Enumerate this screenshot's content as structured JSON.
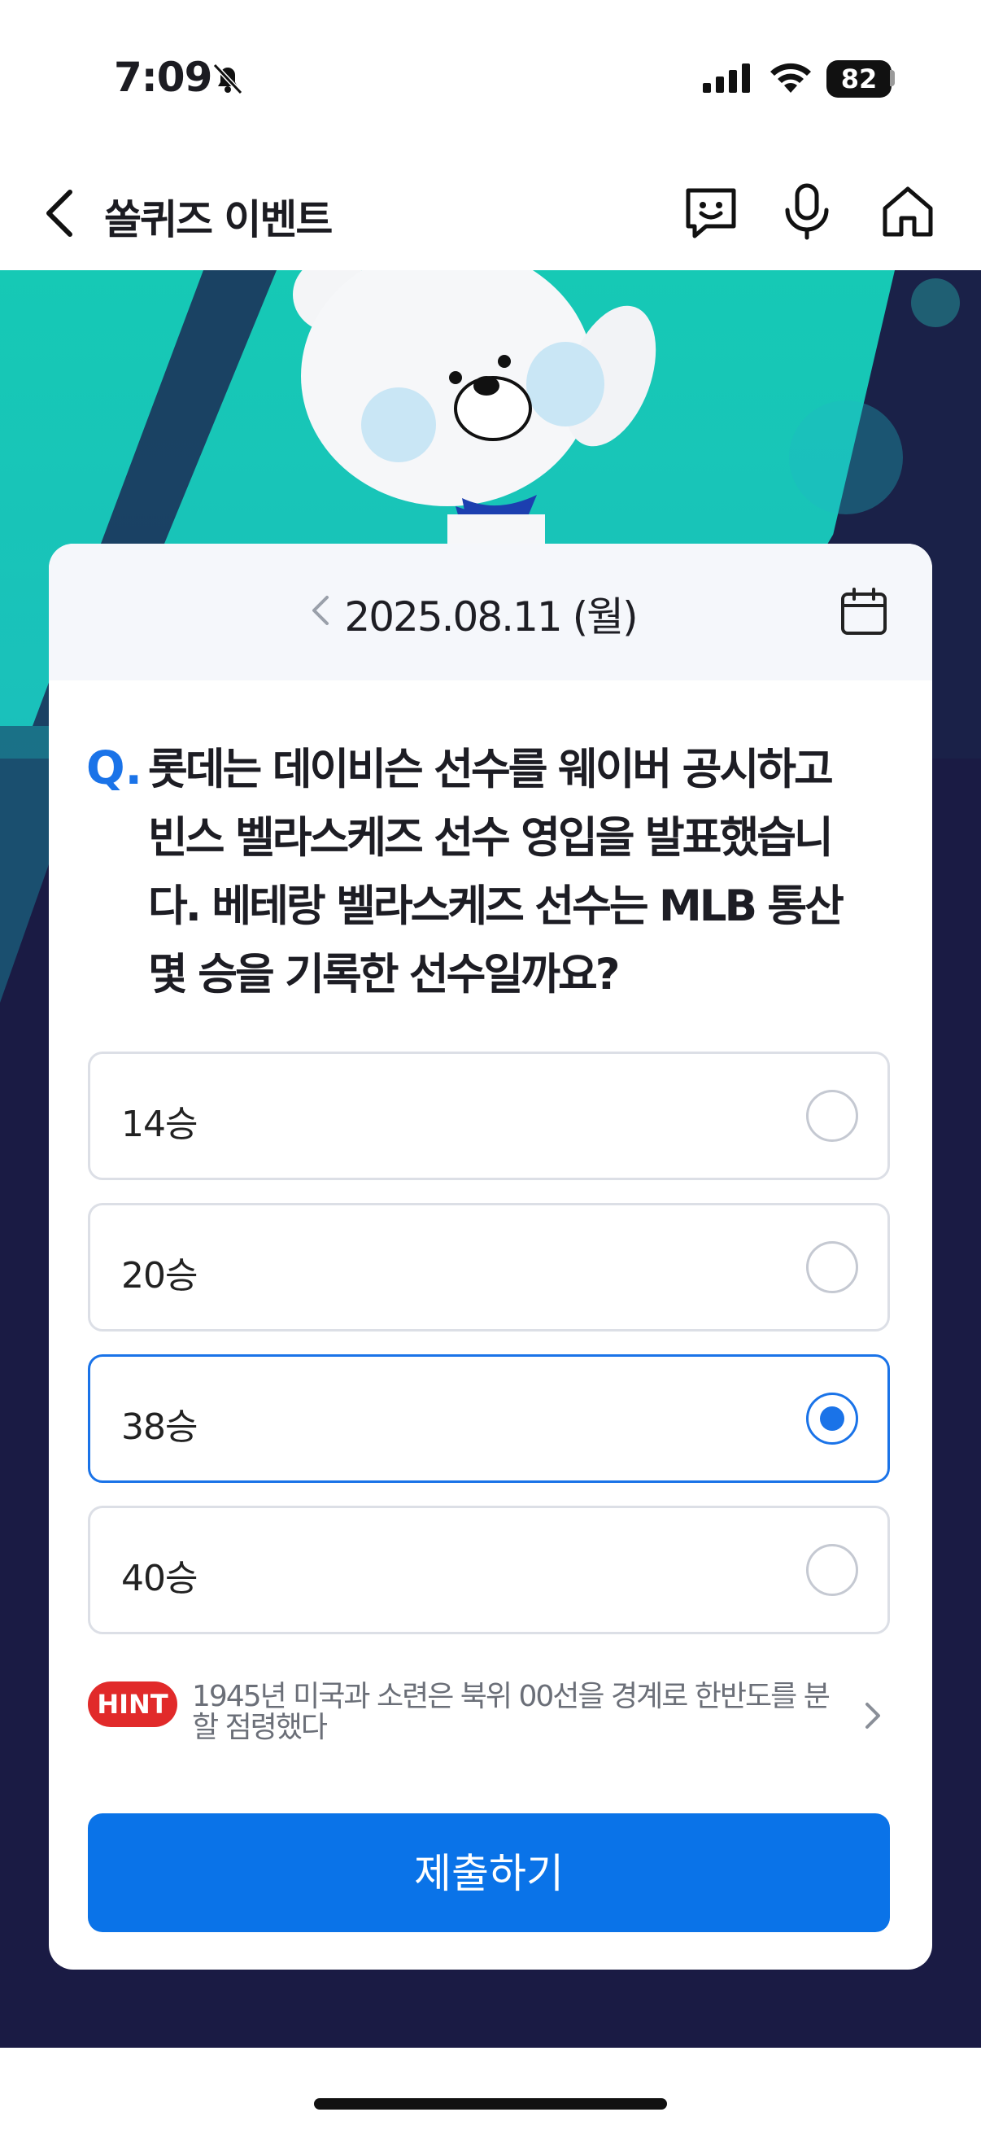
{
  "status_bar": {
    "time": "7:09",
    "battery": "82"
  },
  "nav": {
    "title": "쏠퀴즈 이벤트"
  },
  "quiz": {
    "date": "2025.08.11 (월)",
    "question_prefix": "Q.",
    "question_lines": [
      "롯데는 데이비슨 선수를 웨이버 공시하고",
      "빈스 벨라스케즈 선수 영입을 발표했습니",
      "다. 베테랑 벨라스케즈 선수는 MLB 통산",
      "몇 승을 기록한 선수일까요?"
    ],
    "options": [
      {
        "label": "14승",
        "selected": false
      },
      {
        "label": "20승",
        "selected": false
      },
      {
        "label": "38승",
        "selected": true
      },
      {
        "label": "40승",
        "selected": false
      }
    ],
    "hint": {
      "badge": "HINT",
      "line1": "1945년 미국과 소련은 북위 00선을 경계로 한반도를 분",
      "line2": "할 점령했다"
    },
    "submit_label": "제출하기"
  },
  "colors": {
    "accent": "#1a73e8",
    "hint_badge": "#e12a2a",
    "hero_teal": "#17c7b3",
    "hero_navy": "#1a1b44"
  }
}
